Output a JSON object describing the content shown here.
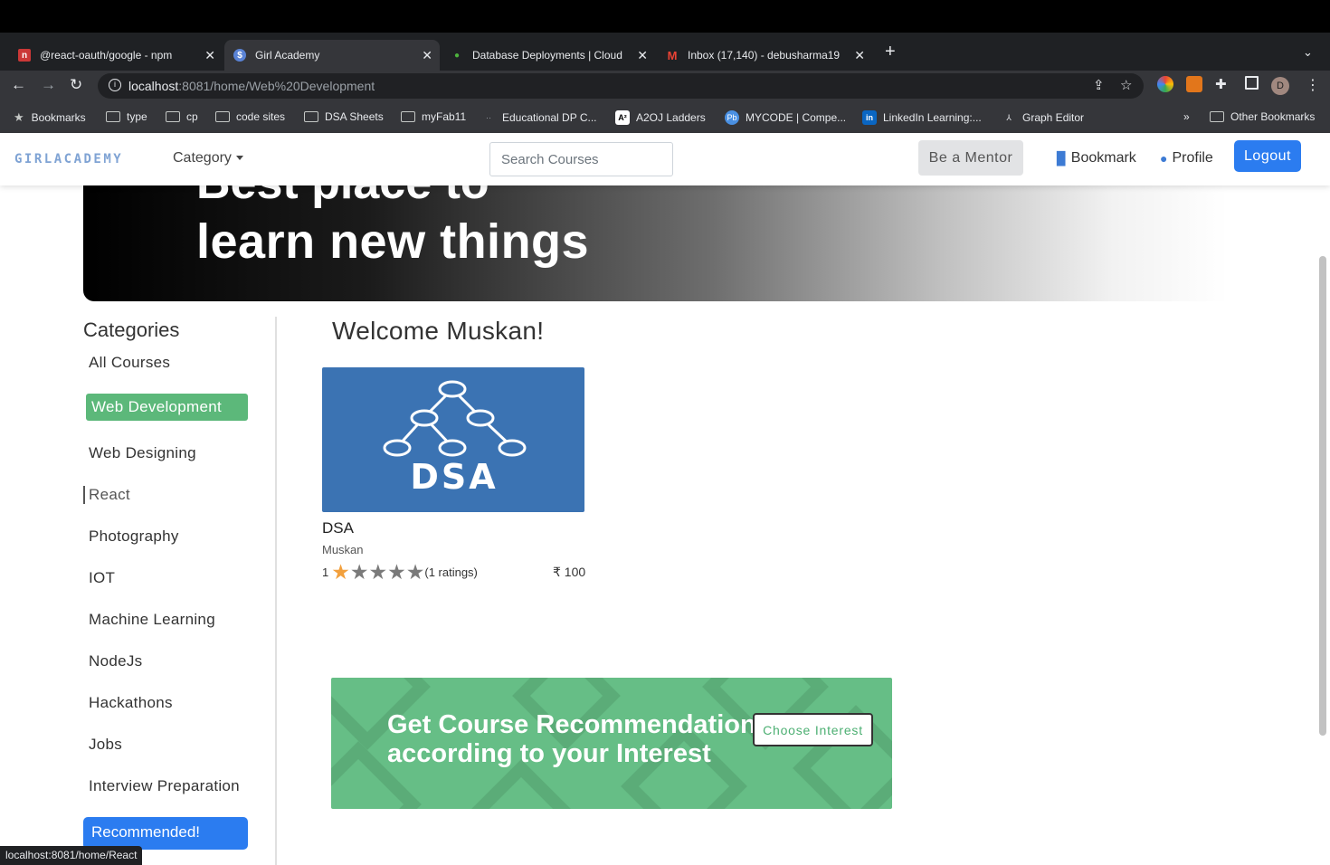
{
  "browser": {
    "tabs": [
      {
        "label": "@react-oauth/google - npm",
        "favicon": "npm",
        "active": false
      },
      {
        "label": "Girl Academy",
        "favicon": "girl-academy",
        "active": true
      },
      {
        "label": "Database Deployments | Cloud",
        "favicon": "mongodb",
        "active": false
      },
      {
        "label": "Inbox (17,140) - debusharma19",
        "favicon": "gmail",
        "active": false
      }
    ],
    "url_host": "localhost",
    "url_path": ":8081/home/Web%20Development",
    "profile_initial": "D",
    "bookmarks": [
      {
        "label": "Bookmarks",
        "icon": "star-icon"
      },
      {
        "label": "type",
        "icon": "folder-icon"
      },
      {
        "label": "cp",
        "icon": "folder-icon"
      },
      {
        "label": "code sites",
        "icon": "folder-icon"
      },
      {
        "label": "DSA Sheets",
        "icon": "folder-icon"
      },
      {
        "label": "myFab11",
        "icon": "folder-icon"
      },
      {
        "label": "Educational DP C...",
        "icon": "site-icon"
      },
      {
        "label": "A2OJ Ladders",
        "icon": "site-icon"
      },
      {
        "label": "MYCODE | Compe...",
        "icon": "site-icon"
      },
      {
        "label": "LinkedIn Learning:...",
        "icon": "linkedin-icon"
      },
      {
        "label": "Graph Editor",
        "icon": "graph-icon"
      }
    ],
    "overflow_label": "»",
    "other_bookmarks": "Other Bookmarks",
    "status_url": "localhost:8081/home/React"
  },
  "navbar": {
    "brand": "GIRLACADEMY",
    "category_label": "Category",
    "search_placeholder": "Search Courses",
    "mentor_label": "Be a Mentor",
    "bookmark_label": "Bookmark",
    "profile_label": "Profile",
    "logout_label": "Logout"
  },
  "hero": {
    "line1": "Best place to",
    "line2": "learn new things"
  },
  "sidebar": {
    "title": "Categories",
    "items": [
      "All Courses",
      "Web Development",
      "Web Designing",
      "React",
      "Photography",
      "IOT",
      "Machine Learning",
      "NodeJs",
      "Hackathons",
      "Jobs",
      "Interview Preparation"
    ],
    "active_item": "Web Development",
    "recommended_label": "Recommended!"
  },
  "main": {
    "welcome": "Welcome Muskan!",
    "courses": [
      {
        "image_text": "DSA",
        "title": "DSA",
        "author": "Muskan",
        "rating_value": "1",
        "stars_filled": 1,
        "stars_total": 5,
        "ratings_text": "(1 ratings)",
        "price": "₹ 100"
      }
    ],
    "recommendation": {
      "line1": "Get Course Recommendation",
      "line2": "according to your Interest",
      "button": "Choose Interest"
    }
  },
  "colors": {
    "accent_blue": "#2b7cf0",
    "active_green": "#5cb87a",
    "banner_green": "#66be86",
    "card_blue": "#3b73b3",
    "star_filled": "#f2a03d",
    "star_empty": "#7a7a7a"
  }
}
